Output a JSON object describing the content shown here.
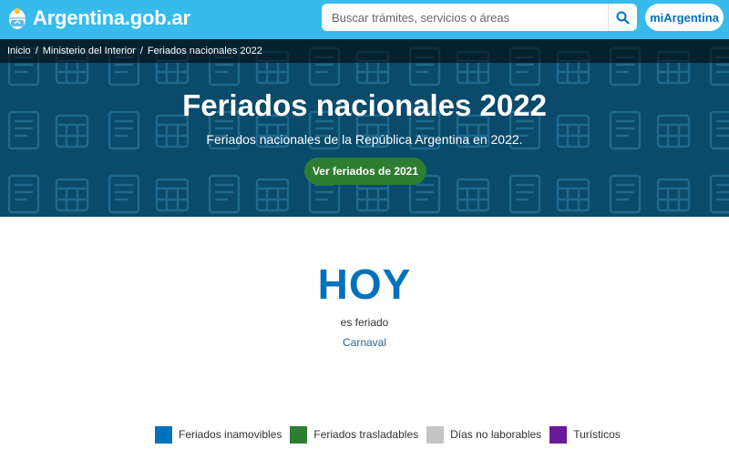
{
  "header": {
    "site_name": "Argentina.gob.ar",
    "search_placeholder": "Buscar trámites, servicios o áreas",
    "account_button": "miArgentina"
  },
  "breadcrumb": {
    "items": [
      "Inicio",
      "Ministerio del Interior",
      "Feriados nacionales 2022"
    ],
    "separator": "/"
  },
  "hero": {
    "title": "Feriados nacionales 2022",
    "subtitle": "Feriados nacionales de la República Argentina en 2022.",
    "button": "Ver feriados de 2021"
  },
  "today": {
    "heading": "HOY",
    "status": "es feriado",
    "holiday_name": "Carnaval"
  },
  "legend": {
    "items": [
      {
        "label": "Feriados inamovibles",
        "color": "#0072bb"
      },
      {
        "label": "Feriados trasladables",
        "color": "#2e7d32"
      },
      {
        "label": "Días no laborables",
        "color": "#c4c4c4"
      },
      {
        "label": "Turísticos",
        "color": "#6a1b9a"
      }
    ]
  },
  "colors": {
    "topbar": "#37bbed",
    "hero_background": "#0a4a6a",
    "accent_blue": "#0072bb",
    "button_green": "#2e7d32"
  }
}
